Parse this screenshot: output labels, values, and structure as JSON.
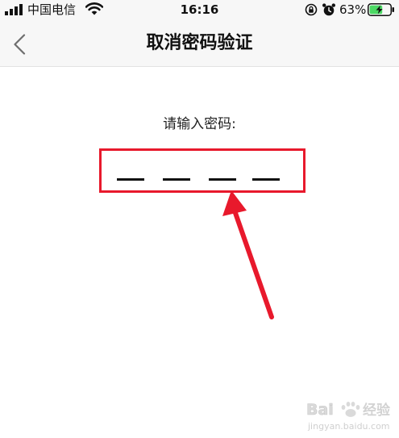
{
  "status_bar": {
    "carrier": "中国电信",
    "time": "16:16",
    "battery_percent": "63%",
    "icons": [
      "signal-icon",
      "wifi-icon",
      "rotation-lock-icon",
      "alarm-icon",
      "battery-charging-icon"
    ],
    "battery_level": 0.63,
    "battery_color": "#4cd964"
  },
  "nav": {
    "title": "取消密码验证",
    "back_icon": "chevron-left-icon"
  },
  "passcode": {
    "prompt": "请输入密码:",
    "digit_count": 4,
    "entered_count": 0,
    "highlight_color": "#e8192c"
  },
  "annotation": {
    "arrow_color": "#e8192c"
  },
  "watermark": {
    "brand": "Baidu",
    "product": "经验",
    "url": "jingyan.baidu.com"
  }
}
